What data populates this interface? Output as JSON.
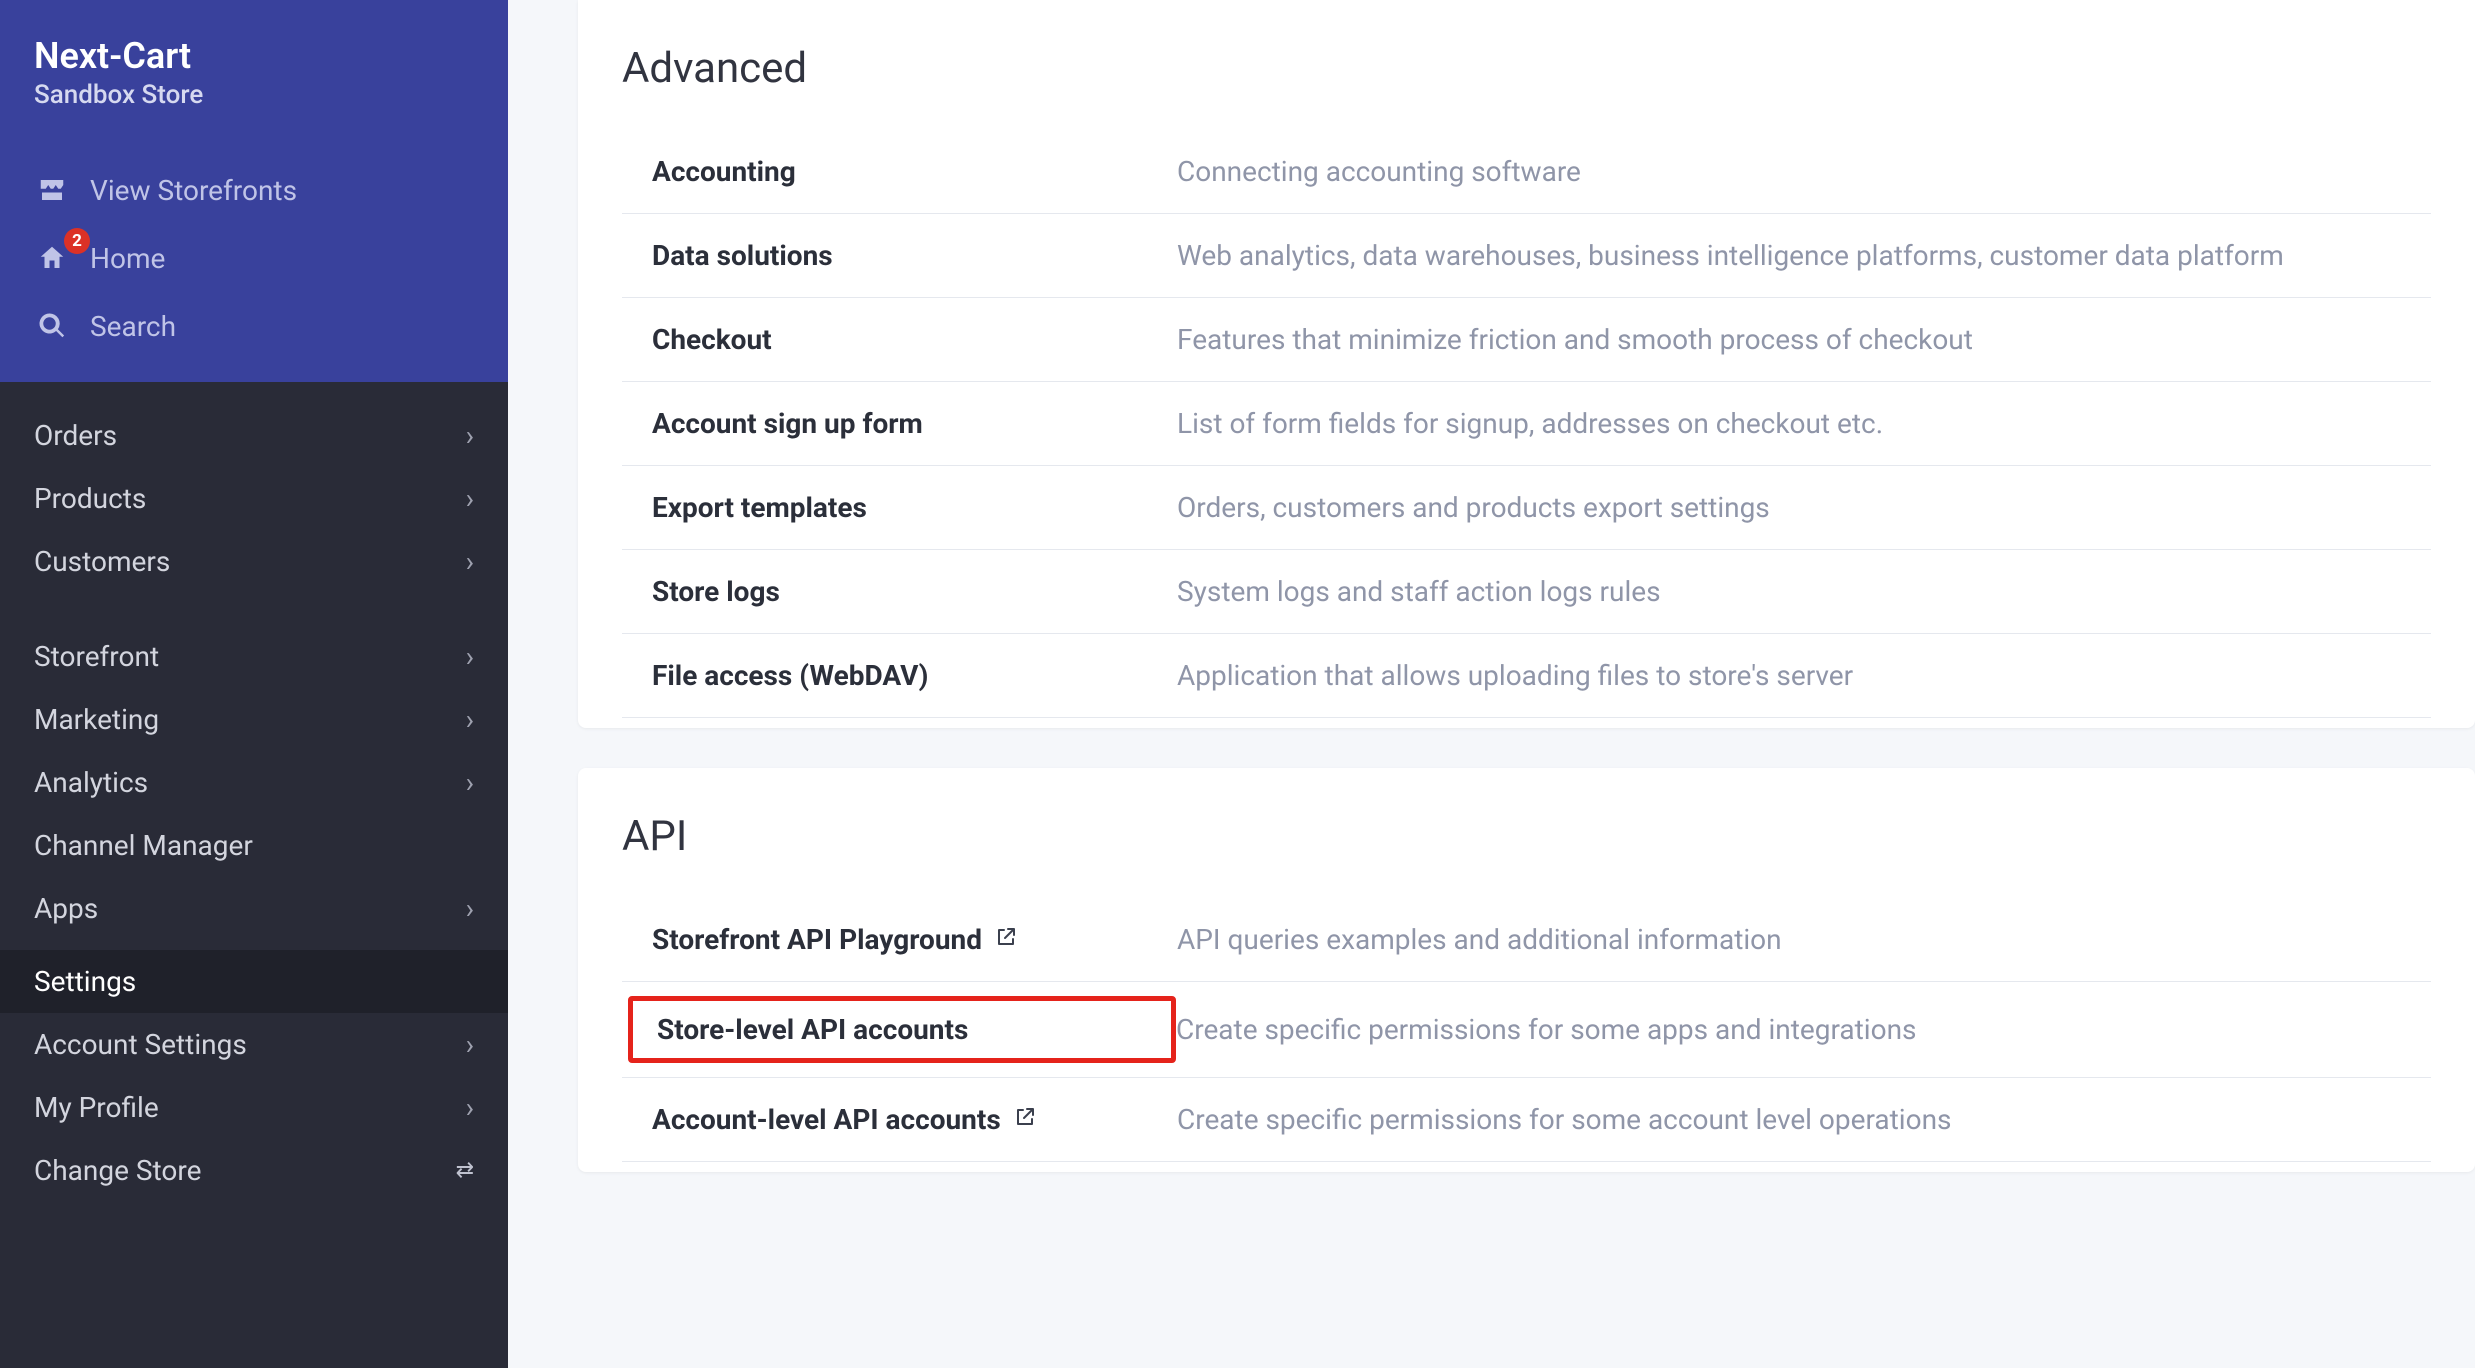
{
  "brand": {
    "title": "Next-Cart",
    "subtitle": "Sandbox Store"
  },
  "quick": {
    "view_storefronts": "View Storefronts",
    "home": "Home",
    "home_badge": "2",
    "search": "Search"
  },
  "nav": {
    "orders": "Orders",
    "products": "Products",
    "customers": "Customers",
    "storefront": "Storefront",
    "marketing": "Marketing",
    "analytics": "Analytics",
    "channel_manager": "Channel Manager",
    "apps": "Apps",
    "settings": "Settings",
    "account_settings": "Account Settings",
    "my_profile": "My Profile",
    "change_store": "Change Store"
  },
  "sections": {
    "advanced": {
      "title": "Advanced",
      "rows": [
        {
          "title": "Accounting",
          "desc": "Connecting accounting software"
        },
        {
          "title": "Data solutions",
          "desc": "Web analytics, data warehouses, business intelligence platforms, customer data platform"
        },
        {
          "title": "Checkout",
          "desc": "Features that minimize friction and smooth process of checkout"
        },
        {
          "title": "Account sign up form",
          "desc": "List of form fields for signup, addresses on checkout etc."
        },
        {
          "title": "Export templates",
          "desc": "Orders, customers and products export settings"
        },
        {
          "title": "Store logs",
          "desc": "System logs and staff action logs rules"
        },
        {
          "title": "File access (WebDAV)",
          "desc": "Application that allows uploading files to store's server"
        }
      ]
    },
    "api": {
      "title": "API",
      "rows": [
        {
          "title": "Storefront API Playground",
          "desc": "API queries examples and additional information"
        },
        {
          "title": "Store-level API accounts",
          "desc": "Create specific permissions for some apps and integrations"
        },
        {
          "title": "Account-level API accounts",
          "desc": "Create specific permissions for some account level operations"
        }
      ]
    }
  }
}
